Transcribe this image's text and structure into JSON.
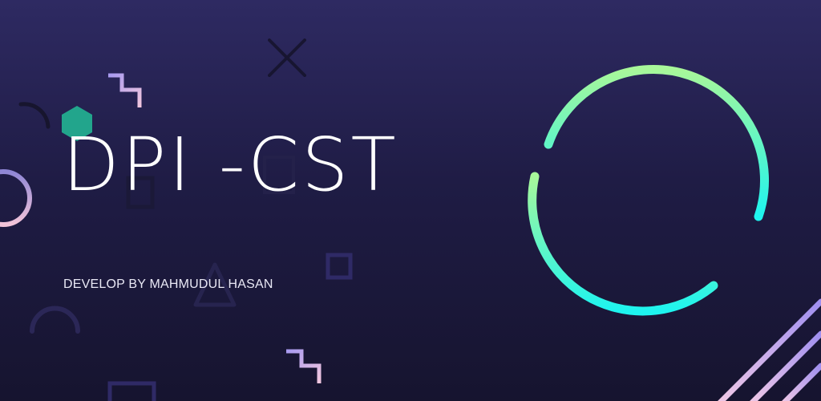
{
  "splash": {
    "title": "DPI -CST",
    "subtitle": "DEVELOP BY MAHMUDUL HASAN"
  },
  "colors": {
    "background_top": "#2e2a62",
    "background_bottom": "#16142f",
    "ring_start": "#a8f79a",
    "ring_end": "#1ef4ef",
    "hexagon": "#22a58c",
    "stripe": "#b79ef2"
  },
  "icons": [
    "hexagon-shape",
    "x-shape",
    "ring-shape",
    "zigzag-shape",
    "triangle-shape",
    "square-outline-shape",
    "arc-shape",
    "diagonal-stripes"
  ]
}
